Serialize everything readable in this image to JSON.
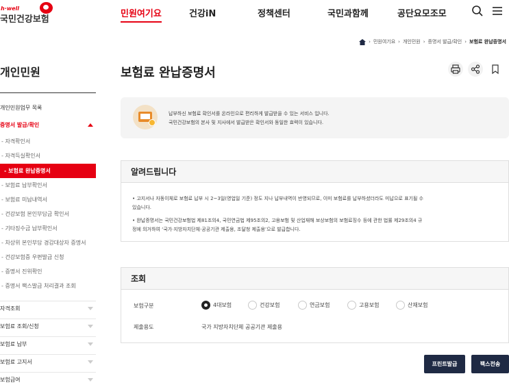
{
  "header": {
    "logo_tagline": "h·well",
    "logo_name": "국민건강보험",
    "nav": [
      "민원여기요",
      "건강iN",
      "정책센터",
      "국민과함께",
      "공단요모조모"
    ],
    "search_icon": "search-icon",
    "menu_icon": "hamburger-menu-icon",
    "brand_color": "#e60012"
  },
  "breadcrumb": [
    "민원여기요",
    "개인민원",
    "증명서 발급/확인",
    "보험료 완납증명서"
  ],
  "sidebar": {
    "title": "개인민원",
    "top_item": "개인민원업무 목록",
    "open_section": "증명서 발급/확인",
    "sub_items": [
      "자격확인서",
      "자격득실확인서",
      "보험료 완납증명서",
      "보험료 납부확인서",
      "보험료 미납내역서",
      "건강보험 본인부담금 확인서",
      "기타징수금 납부확인서",
      "차상위 본인부담 경감대상자 증명서",
      "건강보험증 우편발급 신청",
      "증명서 진위확인",
      "증명서 팩스발급 처리결과 조회"
    ],
    "active_sub": "보험료 완납증명서",
    "sections": [
      "자격조회",
      "보험료 조회/신청",
      "보험료 납부",
      "보험료 고지서",
      "보험급여"
    ]
  },
  "page": {
    "title": "보험료 완납증명서",
    "tools": [
      "print-icon",
      "share-icon",
      "bookmark-icon"
    ],
    "info_lines": [
      "납부하신 보험료 확인서를 온라인으로 편리하게 발급받을 수 있는 서비스 입니다.",
      "국민건강보험의 본사 및 지사에서 발급받은 확인서와 동일한 효력이 있습니다."
    ],
    "notice_title": "알려드립니다",
    "notice_lines": [
      "• 고지서나 자동이체로 보험료 납부 시 2~3일(영업일 기준) 정도 지나 납부내역이 반영되므로, 이미 보험료를 납부하셨더라도 미납으로 표기될 수",
      "  있습니다.",
      "• 완납증명서는 국민건강보험법 제81조의4, 국민연금법 제95조의2, 고용보험 및 산업재해 보상보험의 보험료징수 등에 관한 법률 제29조의4 규",
      "  정에 의거하여 ‘국가·지방자치단체·공공기관 제출용, 조달청 제출용’으로 발급합니다."
    ],
    "query_title": "조회",
    "insurance_label": "보험구분",
    "insurance_options": [
      "4대보험",
      "건강보험",
      "연금보험",
      "고용보험",
      "산재보험"
    ],
    "insurance_selected": "4대보험",
    "purpose_label": "제출용도",
    "purpose_value": "국가 지방자치단체 공공기관 제출용",
    "buttons": [
      "프린트발급",
      "팩스전송"
    ]
  }
}
